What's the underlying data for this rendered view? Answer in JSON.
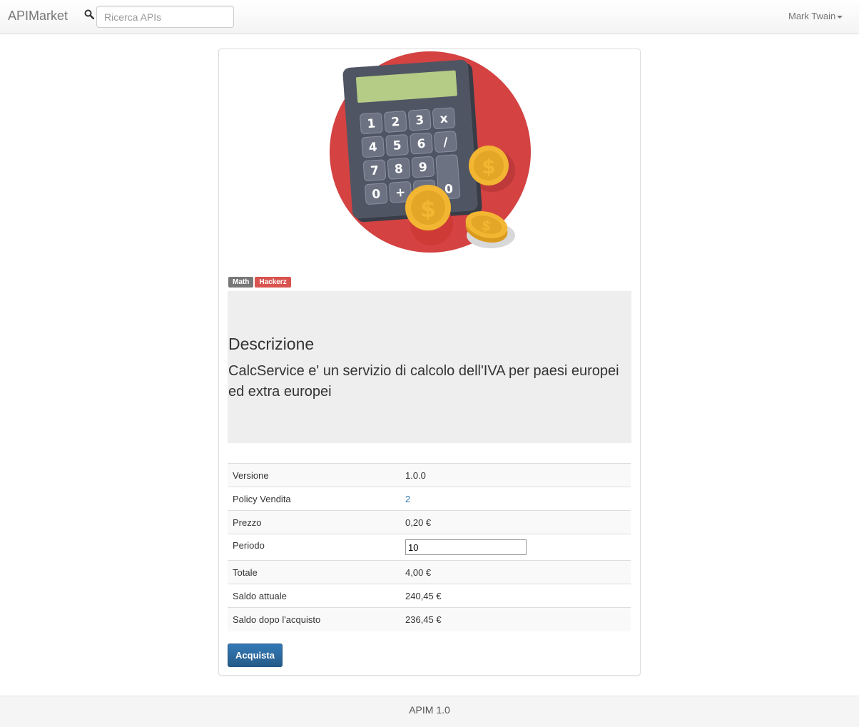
{
  "navbar": {
    "brand": "APIMarket",
    "search_placeholder": "Ricerca APIs",
    "user_name": "Mark Twain"
  },
  "calculator": {
    "keys": [
      "1",
      "2",
      "3",
      "x",
      "4",
      "5",
      "6",
      "/",
      "7",
      "8",
      "9",
      "0",
      "+",
      "-",
      "0"
    ],
    "colors": {
      "circle": "#d44242",
      "body": "#4f5563",
      "screen": "#b5cc86",
      "coin": "#f2b632"
    }
  },
  "tags": {
    "math": "Math",
    "hackerz": "Hackerz"
  },
  "description": {
    "title": "Descrizione",
    "text": "CalcService e' un servizio di calcolo dell'IVA per paesi europei ed extra europei"
  },
  "details": {
    "versione_label": "Versione",
    "versione_value": "1.0.0",
    "policy_label": "Policy Vendita",
    "policy_value": "2",
    "prezzo_label": "Prezzo",
    "prezzo_value": "0,20 €",
    "periodo_label": "Periodo",
    "periodo_value": "10",
    "totale_label": "Totale",
    "totale_value": "4,00 €",
    "saldo_label": "Saldo attuale",
    "saldo_value": "240,45 €",
    "saldo_dopo_label": "Saldo dopo l'acquisto",
    "saldo_dopo_value": "236,45 €"
  },
  "buy_button": "Acquista",
  "footer": "APIM 1.0",
  "colors": {
    "primary": "#337ab7",
    "danger": "#d9534f",
    "tag_default": "#777777"
  }
}
